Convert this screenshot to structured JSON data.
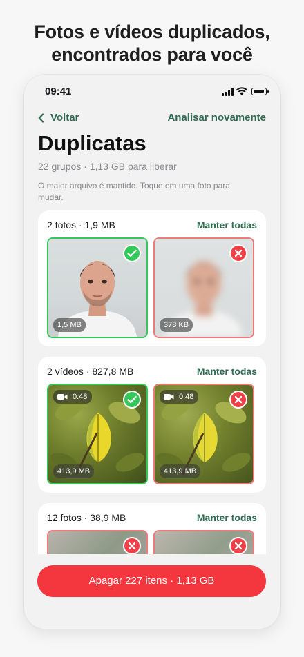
{
  "headline": {
    "line1": "Fotos e vídeos duplicados,",
    "line2": "encontrados para você"
  },
  "status_bar": {
    "time": "09:41",
    "icons": [
      "signal-icon",
      "wifi-icon",
      "battery-icon"
    ]
  },
  "nav": {
    "back_label": "Voltar",
    "reanalyze_label": "Analisar novamente"
  },
  "header": {
    "title": "Duplicatas",
    "subtitle": "22 grupos · 1,13 GB para liberar",
    "hint": "O maior arquivo é mantido. Toque em uma foto para mudar."
  },
  "groups": [
    {
      "title": "2 fotos · 1,9 MB",
      "keep_all_label": "Manter todas",
      "items": [
        {
          "size": "1,5 MB",
          "status": "keep"
        },
        {
          "size": "378 KB",
          "status": "delete"
        }
      ]
    },
    {
      "title": "2 vídeos · 827,8 MB",
      "keep_all_label": "Manter todas",
      "items": [
        {
          "size": "413,9 MB",
          "duration": "0:48",
          "status": "keep"
        },
        {
          "size": "413,9 MB",
          "duration": "0:48",
          "status": "delete"
        }
      ]
    },
    {
      "title": "12 fotos · 38,9 MB",
      "keep_all_label": "Manter todas",
      "items": [
        {
          "status": "delete"
        },
        {
          "status": "delete"
        }
      ]
    }
  ],
  "delete_button": {
    "label": "Apagar 227 itens · 1,13 GB"
  },
  "colors": {
    "accent_green": "#2e6b51",
    "keep_green": "#34c759",
    "delete_red": "#f4373f"
  }
}
